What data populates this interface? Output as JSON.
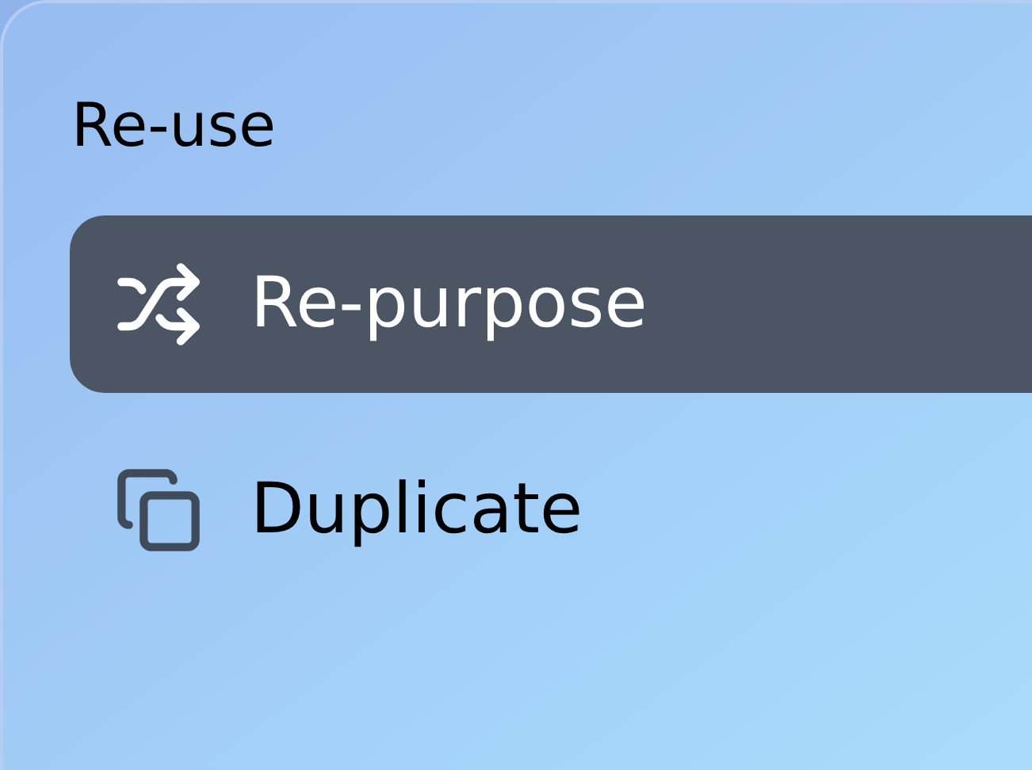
{
  "section": {
    "title": "Re-use"
  },
  "items": [
    {
      "kind": "shuffle",
      "label": "Re-purpose",
      "selected": true
    },
    {
      "kind": "copy",
      "label": "Duplicate",
      "selected": false
    }
  ]
}
